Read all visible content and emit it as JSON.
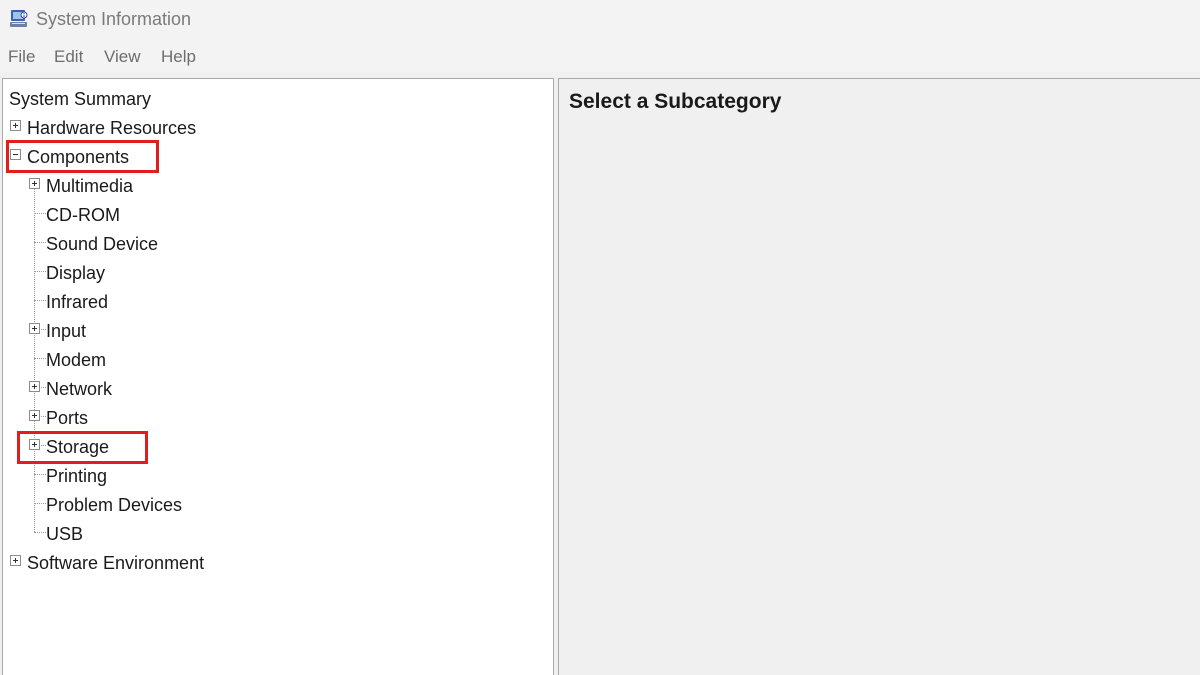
{
  "window": {
    "title": "System Information",
    "app_icon": "system-information-icon"
  },
  "menu": [
    "File",
    "Edit",
    "View",
    "Help"
  ],
  "tree": {
    "system_summary": "System Summary",
    "hardware_resources": "Hardware Resources",
    "components": "Components",
    "children": {
      "multimedia": "Multimedia",
      "cd_rom": "CD-ROM",
      "sound_device": "Sound Device",
      "display": "Display",
      "infrared": "Infrared",
      "input": "Input",
      "modem": "Modem",
      "network": "Network",
      "ports": "Ports",
      "storage": "Storage",
      "printing": "Printing",
      "problem_devices": "Problem Devices",
      "usb": "USB"
    },
    "software_environment": "Software Environment"
  },
  "detail": {
    "heading": "Select a Subcategory"
  },
  "colors": {
    "highlight": "#e01e1e",
    "tree_background": "#ffffff",
    "detail_background": "#f0f0f0"
  }
}
